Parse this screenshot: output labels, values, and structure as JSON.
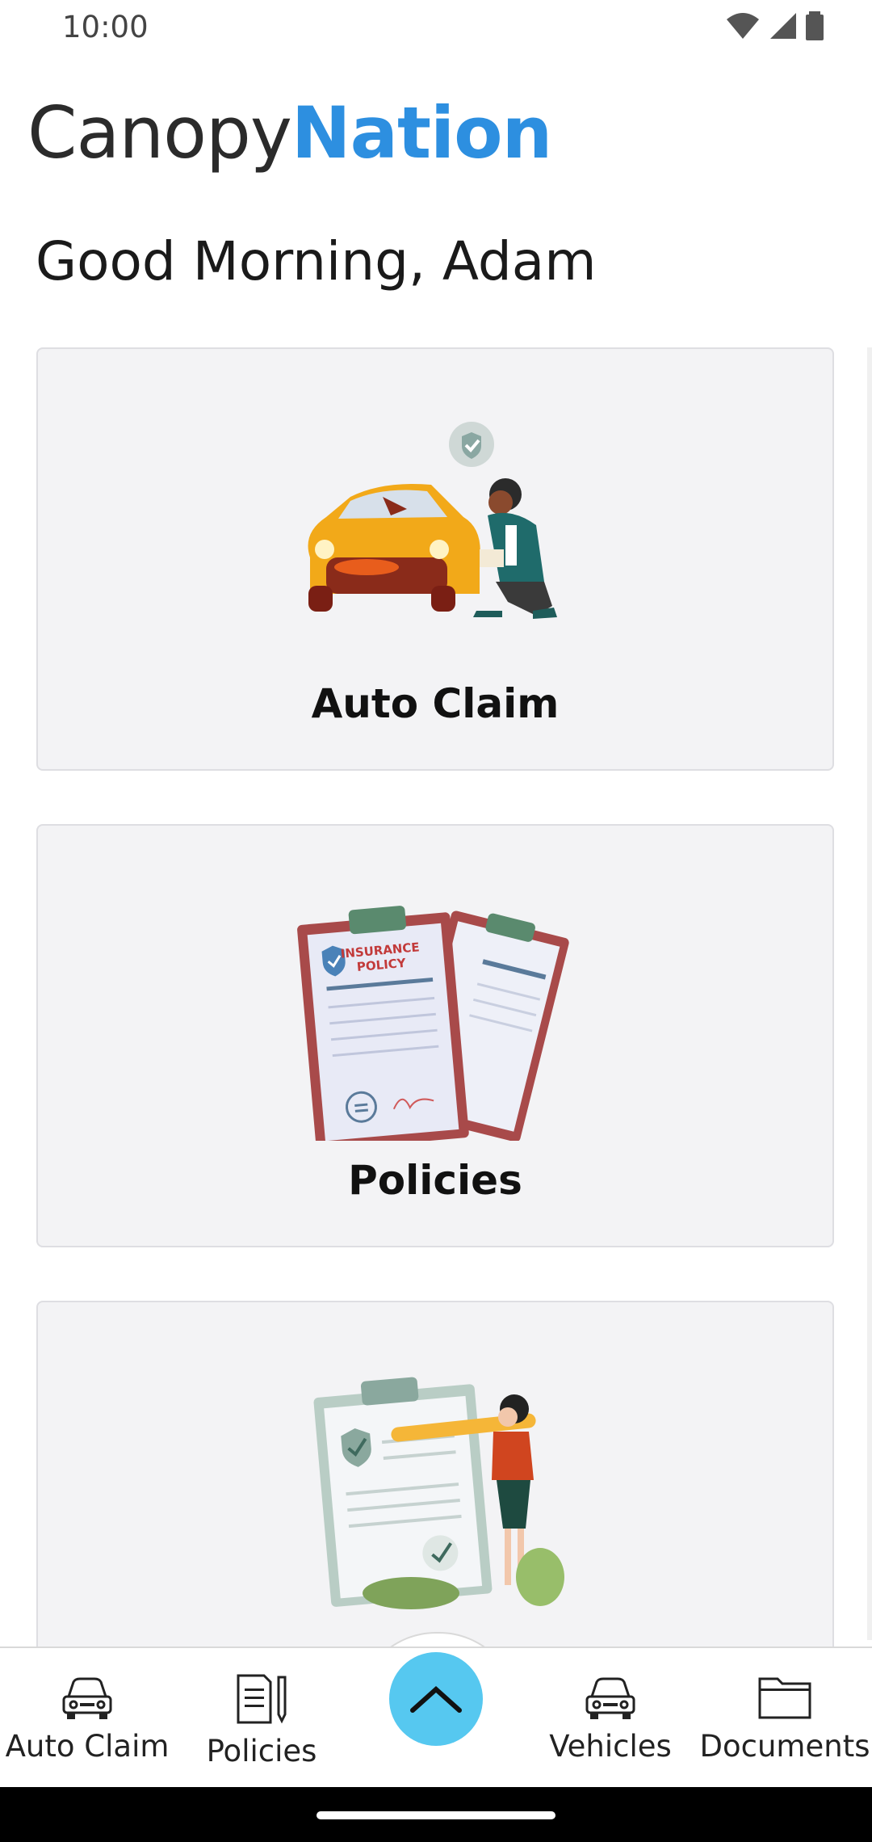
{
  "status": {
    "time": "10:00"
  },
  "logo": {
    "part1": "Canopy",
    "part2": "Nation"
  },
  "greeting": "Good Morning, Adam",
  "cards": [
    {
      "label": "Auto Claim",
      "illustration": "person-inspecting-car"
    },
    {
      "label": "Policies",
      "illustration": "insurance-policy-clipboards"
    },
    {
      "label": "",
      "illustration": "woman-with-checklist-clipboard"
    }
  ],
  "policy_doc": {
    "line1": "INSURANCE",
    "line2": "POLICY"
  },
  "nav": {
    "items": [
      {
        "label": "Auto Claim",
        "icon": "car-icon"
      },
      {
        "label": "Policies",
        "icon": "policy-document-icon"
      },
      {
        "label": "Vehicles",
        "icon": "car-icon"
      },
      {
        "label": "Documents",
        "icon": "folder-icon"
      }
    ],
    "fab_icon": "chevron-up-icon"
  },
  "colors": {
    "brand_blue": "#2d8fe0",
    "fab": "#56c8f0",
    "card_bg": "#f3f3f5"
  }
}
